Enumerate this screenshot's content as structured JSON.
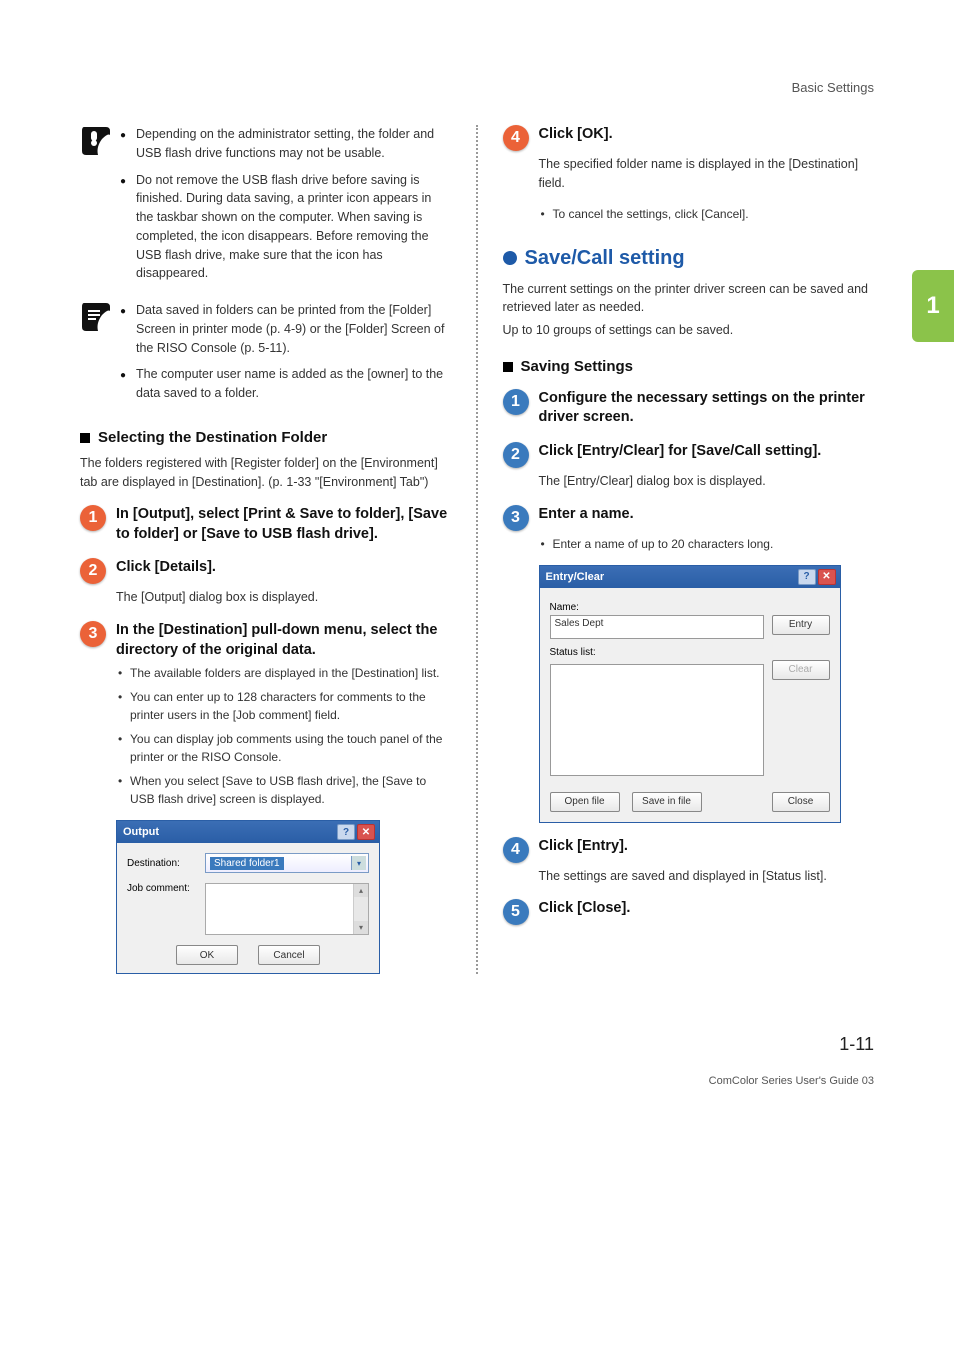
{
  "header": {
    "breadcrumb": "Basic Settings"
  },
  "chapter_tab": "1",
  "left": {
    "warning_notes": [
      "Depending on the administrator setting, the folder and USB flash drive functions may not be usable.",
      "Do not remove the USB flash drive before saving is finished. During data saving, a printer icon appears in the taskbar shown on the computer. When saving is completed, the icon disappears. Before removing the USB flash drive, make sure that the icon has disappeared."
    ],
    "tip_notes": [
      "Data saved in folders can be printed from the [Folder] Screen in printer mode (p. 4-9) or the [Folder] Screen of the RISO Console (p. 5-11).",
      "The computer user name is added as the [owner] to the data saved to a folder."
    ],
    "section1": {
      "title": "Selecting the Destination Folder",
      "intro": "The folders registered with [Register folder] on the [Environment] tab are displayed in [Destination]. (p. 1-33 \"[Environment] Tab\")"
    },
    "step1": {
      "num": "1",
      "title": "In [Output], select [Print & Save to folder], [Save to folder] or [Save to USB flash drive]."
    },
    "step2": {
      "num": "2",
      "title": "Click [Details].",
      "body": "The [Output] dialog box is displayed."
    },
    "step3": {
      "num": "3",
      "title": "In the [Destination] pull-down menu, select the directory of the original data.",
      "bullets": [
        "The available folders are displayed in the [Destination] list.",
        "You can enter up to 128 characters for comments to the printer users in the [Job comment] field.",
        "You can display job comments using the touch panel of the printer or the RISO Console.",
        "When you select [Save to USB flash drive], the [Save to USB flash drive] screen is displayed."
      ]
    },
    "output_dialog": {
      "title": "Output",
      "destination_label": "Destination:",
      "destination_value": "Shared folder1",
      "jobcomment_label": "Job comment:",
      "ok": "OK",
      "cancel": "Cancel"
    }
  },
  "right": {
    "step4": {
      "num": "4",
      "title": "Click [OK].",
      "body": "The specified folder name is displayed in the [Destination] field.",
      "bullet": "To cancel the settings, click [Cancel]."
    },
    "feature": {
      "title": "Save/Call setting",
      "intro1": "The current settings on the printer driver screen can be saved and retrieved later as needed.",
      "intro2": "Up to 10 groups of settings can be saved."
    },
    "section2": {
      "title": "Saving Settings"
    },
    "sstep1": {
      "num": "1",
      "title": "Configure the necessary settings on the printer driver screen."
    },
    "sstep2": {
      "num": "2",
      "title": "Click [Entry/Clear] for [Save/Call setting].",
      "body": "The [Entry/Clear] dialog box is displayed."
    },
    "sstep3": {
      "num": "3",
      "title": "Enter a name.",
      "bullet": "Enter a name of up to 20 characters long."
    },
    "entry_dialog": {
      "title": "Entry/Clear",
      "name_label": "Name:",
      "name_value": "Sales Dept",
      "status_label": "Status list:",
      "entry_btn": "Entry",
      "clear_btn": "Clear",
      "open_btn": "Open file",
      "save_btn": "Save in file",
      "close_btn": "Close"
    },
    "sstep4": {
      "num": "4",
      "title": "Click [Entry].",
      "body": "The settings are saved and displayed in [Status list]."
    },
    "sstep5": {
      "num": "5",
      "title": "Click [Close]."
    }
  },
  "footer": {
    "page": "1-11",
    "line": "ComColor Series User's Guide 03"
  }
}
